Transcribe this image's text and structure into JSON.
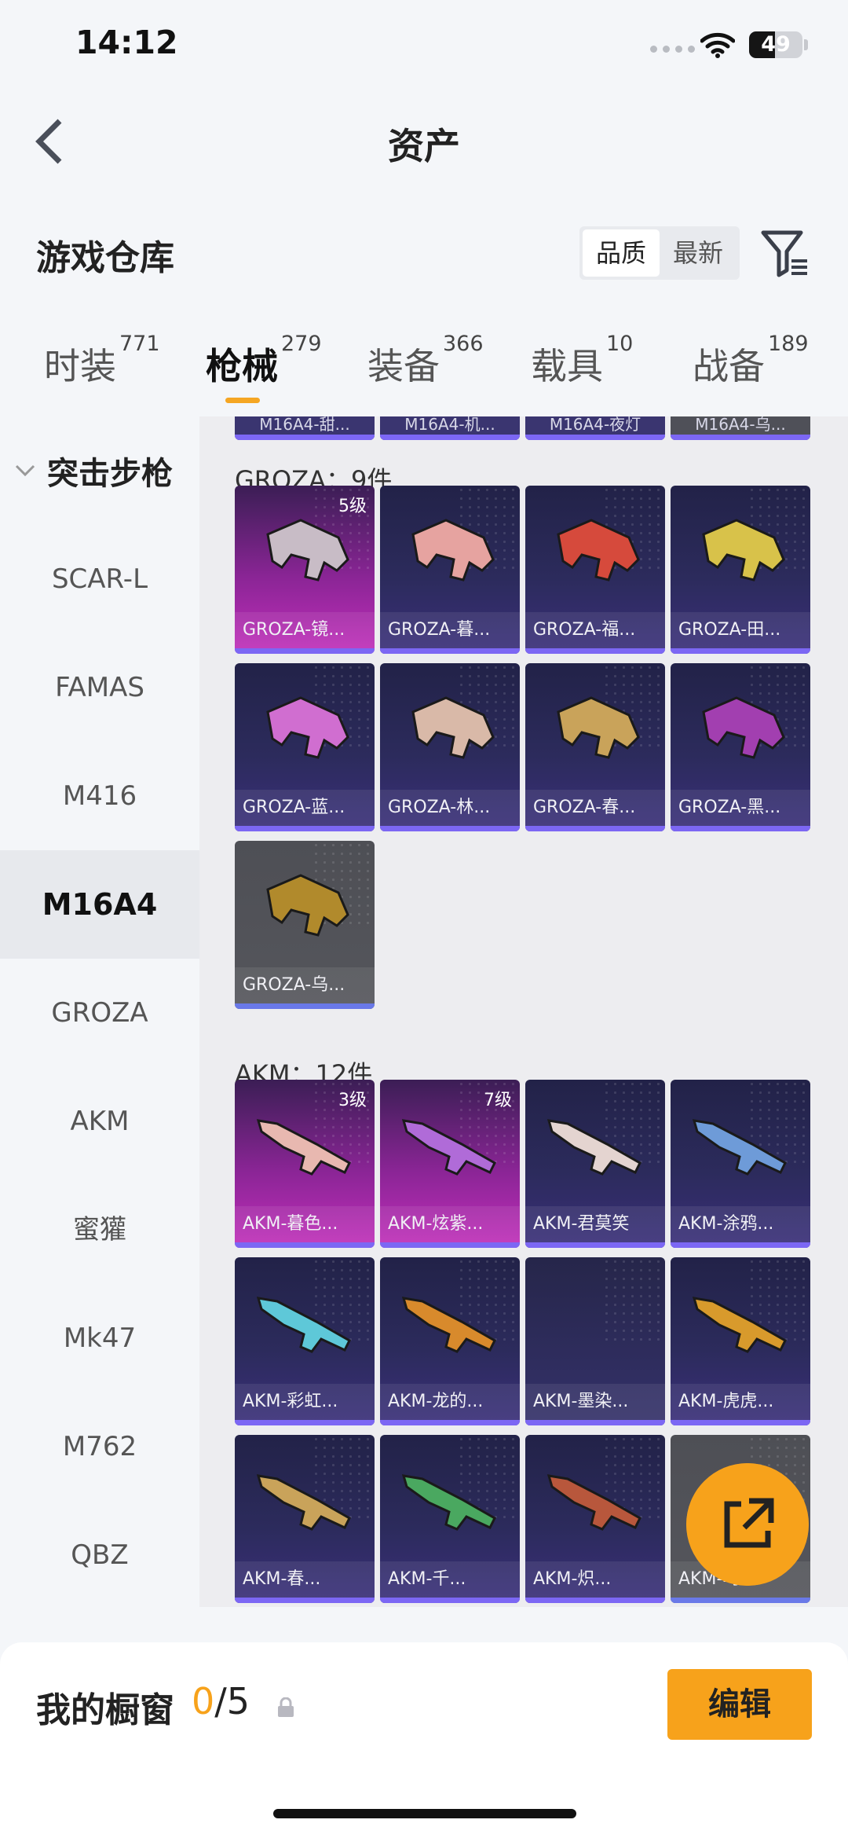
{
  "status_bar": {
    "time": "14:12",
    "battery": "49",
    "battery_level": 0.49
  },
  "header": {
    "title": "资产"
  },
  "warehouse": {
    "title": "游戏仓库",
    "sort_options": [
      "品质",
      "最新"
    ],
    "sort_active": 0
  },
  "tabs": [
    {
      "label": "时装",
      "count": "771"
    },
    {
      "label": "枪械",
      "count": "279"
    },
    {
      "label": "装备",
      "count": "366"
    },
    {
      "label": "载具",
      "count": "10"
    },
    {
      "label": "战备",
      "count": "189"
    }
  ],
  "sidebar": {
    "header": "突击步枪",
    "items": [
      "SCAR-L",
      "FAMAS",
      "M416",
      "M16A4",
      "GROZA",
      "AKM",
      "蜜獾",
      "Mk47",
      "M762",
      "QBZ"
    ],
    "active": "M16A4"
  },
  "top_cut_items": [
    "M16A4-甜...",
    "M16A4-机...",
    "M16A4-夜灯",
    "M16A4-乌..."
  ],
  "groups": [
    {
      "title": "GROZA：9件",
      "items": [
        {
          "name": "GROZA-镜...",
          "level": "5级",
          "tier": "pink",
          "color": "#c8bcc6"
        },
        {
          "name": "GROZA-暮...",
          "level": "",
          "tier": "purple",
          "color": "#e6a3a0"
        },
        {
          "name": "GROZA-福...",
          "level": "",
          "tier": "purple",
          "color": "#d64a3c"
        },
        {
          "name": "GROZA-田...",
          "level": "",
          "tier": "purple",
          "color": "#d8c24a"
        },
        {
          "name": "GROZA-蓝...",
          "level": "",
          "tier": "purple",
          "color": "#d06ed0"
        },
        {
          "name": "GROZA-林...",
          "level": "",
          "tier": "purple",
          "color": "#d9b9a8"
        },
        {
          "name": "GROZA-春...",
          "level": "",
          "tier": "purple",
          "color": "#c9a35a"
        },
        {
          "name": "GROZA-黑...",
          "level": "",
          "tier": "purple",
          "color": "#a23fb0"
        },
        {
          "name": "GROZA-乌...",
          "level": "",
          "tier": "grey",
          "color": "#b18a2c"
        }
      ]
    },
    {
      "title": "AKM：12件",
      "items": [
        {
          "name": "AKM-暮色...",
          "level": "3级",
          "tier": "pink",
          "color": "#e8b8b0"
        },
        {
          "name": "AKM-炫紫...",
          "level": "7级",
          "tier": "pink",
          "color": "#b06bd8"
        },
        {
          "name": "AKM-君莫笑",
          "level": "",
          "tier": "purple",
          "color": "#e4d4d0"
        },
        {
          "name": "AKM-涂鸦...",
          "level": "",
          "tier": "purple",
          "color": "#6e9bd8"
        },
        {
          "name": "AKM-彩虹...",
          "level": "",
          "tier": "purple",
          "color": "#5ec8d8"
        },
        {
          "name": "AKM-龙的...",
          "level": "",
          "tier": "purple",
          "color": "#d88a2c"
        },
        {
          "name": "AKM-墨染...",
          "level": "",
          "tier": "empty",
          "color": ""
        },
        {
          "name": "AKM-虎虎...",
          "level": "",
          "tier": "purple",
          "color": "#d89a2c"
        },
        {
          "name": "AKM-春...",
          "level": "",
          "tier": "purple",
          "color": "#c9a35a"
        },
        {
          "name": "AKM-千...",
          "level": "",
          "tier": "purple",
          "color": "#4aa860"
        },
        {
          "name": "AKM-炽...",
          "level": "",
          "tier": "purple",
          "color": "#b8573c"
        },
        {
          "name": "AKM-乌...",
          "level": "",
          "tier": "grey",
          "color": ""
        }
      ]
    }
  ],
  "bottom": {
    "label": "我的橱窗",
    "count": "0",
    "total": "/5",
    "edit_label": "编辑"
  },
  "colors": {
    "accent": "#f7a21b",
    "card_bar": "#7c67f4"
  }
}
